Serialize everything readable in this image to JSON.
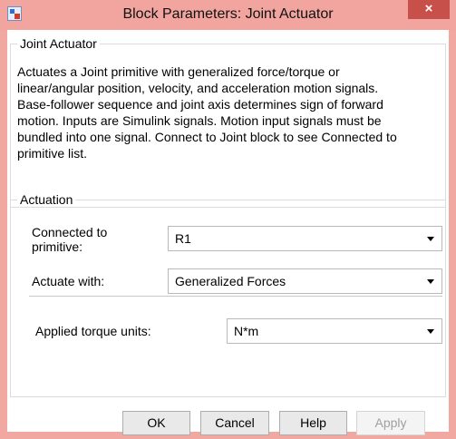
{
  "window": {
    "title": "Block Parameters: Joint Actuator",
    "close_label": "×"
  },
  "description_group": {
    "legend": "Joint Actuator",
    "lines": [
      "Actuates a Joint primitive with generalized force/torque or",
      "linear/angular position, velocity, and acceleration motion signals.",
      "Base-follower sequence and joint axis determines sign of forward",
      "motion. Inputs are Simulink signals. Motion input signals must be",
      "bundled into one signal. Connect to Joint block to see Connected to",
      "primitive list."
    ]
  },
  "actuation_group": {
    "legend": "Actuation",
    "connected_label_line1": "Connected to",
    "connected_label_line2": "primitive:",
    "connected_value": "R1",
    "actuate_label": "Actuate with:",
    "actuate_value": "Generalized Forces",
    "units_label": "Applied torque units:",
    "units_value": "N*m"
  },
  "buttons": {
    "ok": "OK",
    "cancel": "Cancel",
    "help": "Help",
    "apply": "Apply"
  }
}
